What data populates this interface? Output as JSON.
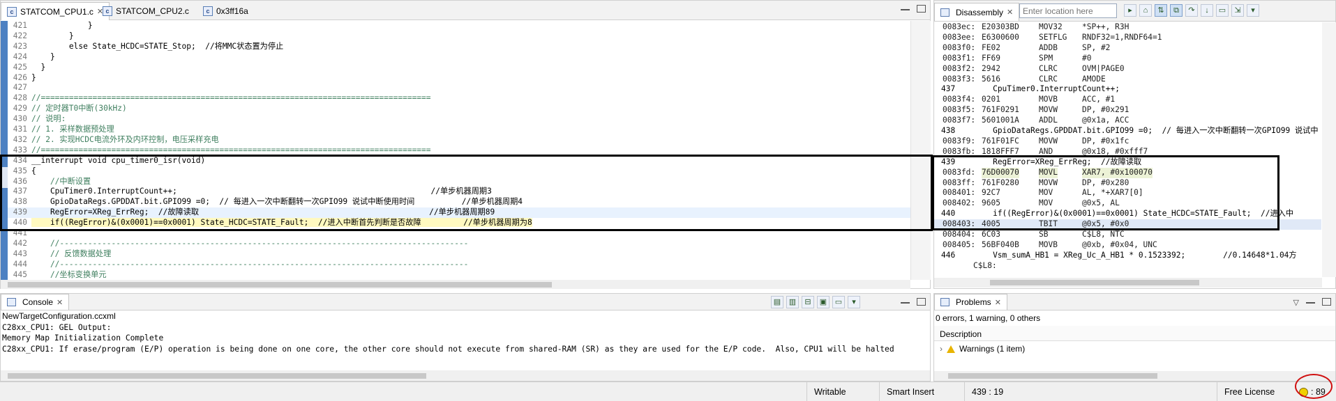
{
  "editor": {
    "tabs": [
      {
        "label": "STATCOM_CPU1.c",
        "active": true
      },
      {
        "label": "STATCOM_CPU2.c",
        "active": false
      },
      {
        "label": "0x3ff16a",
        "active": false
      }
    ],
    "lines": [
      {
        "n": "421",
        "text": "            }"
      },
      {
        "n": "422",
        "text": "        }"
      },
      {
        "n": "423",
        "text": "        else State_HCDC=STATE_Stop;  //将MMC状态置为停止"
      },
      {
        "n": "424",
        "text": "    }"
      },
      {
        "n": "425",
        "text": "  }"
      },
      {
        "n": "426",
        "text": "}"
      },
      {
        "n": "427",
        "text": ""
      },
      {
        "n": "428",
        "text": "//==================================================================================="
      },
      {
        "n": "429",
        "text": "// 定时器T0中断(30kHz)"
      },
      {
        "n": "430",
        "text": "// 说明:"
      },
      {
        "n": "431",
        "text": "// 1. 采样数据预处理"
      },
      {
        "n": "432",
        "text": "// 2. 实现HCDC电流外环及内环控制，电压采样充电"
      },
      {
        "n": "433",
        "text": "//==================================================================================="
      },
      {
        "n": "434",
        "text": "__interrupt void cpu_timer0_isr(void)"
      },
      {
        "n": "435",
        "text": "{"
      },
      {
        "n": "436",
        "text": "    //中断设置"
      },
      {
        "n": "437",
        "text": "    CpuTimer0.InterruptCount++;                                                      //单步机器周期3"
      },
      {
        "n": "438",
        "text": "    GpioDataRegs.GPDDAT.bit.GPIO99 =0;  // 每进入一次中断翻转一次GPIO99 说试中断使用时间          //单步机器周期4"
      },
      {
        "n": "439",
        "text": "    RegError=XReg_ErrReg;  //故障读取                                                 //单步机器周期89"
      },
      {
        "n": "440",
        "text": "    if((RegError)&(0x0001)==0x0001) State_HCDC=STATE_Fault;  //进入中断首先判断是否故障         //单步机器周期为8"
      },
      {
        "n": "441",
        "text": ""
      },
      {
        "n": "442",
        "text": "    //---------------------------------------------------------------------------------------"
      },
      {
        "n": "443",
        "text": "    // 反馈数据处理"
      },
      {
        "n": "444",
        "text": "    //---------------------------------------------------------------------------------------"
      },
      {
        "n": "445",
        "text": "    //坐标变换单元"
      }
    ]
  },
  "disassembly": {
    "tab_label": "Disassembly",
    "location_placeholder": "Enter location here",
    "rows": [
      {
        "kind": "ins",
        "addr": "0083ec:",
        "bytes": "E20303BD",
        "op": "MOV32",
        "arg": "*SP++, R3H"
      },
      {
        "kind": "ins",
        "addr": "0083ee:",
        "bytes": "E6300600",
        "op": "SETFLG",
        "arg": "RNDF32=1,RNDF64=1"
      },
      {
        "kind": "ins",
        "addr": "0083f0:",
        "bytes": "FE02",
        "op": "ADDB",
        "arg": "SP, #2"
      },
      {
        "kind": "ins",
        "addr": "0083f1:",
        "bytes": "FF69",
        "op": "SPM",
        "arg": "#0"
      },
      {
        "kind": "ins",
        "addr": "0083f2:",
        "bytes": "2942",
        "op": "CLRC",
        "arg": "OVM|PAGE0"
      },
      {
        "kind": "ins",
        "addr": "0083f3:",
        "bytes": "5616",
        "op": "CLRC",
        "arg": "AMODE"
      },
      {
        "kind": "src",
        "text": "437        CpuTimer0.InterruptCount++;"
      },
      {
        "kind": "ins",
        "addr": "0083f4:",
        "bytes": "0201",
        "op": "MOVB",
        "arg": "ACC, #1"
      },
      {
        "kind": "ins",
        "addr": "0083f5:",
        "bytes": "761F0291",
        "op": "MOVW",
        "arg": "DP, #0x291"
      },
      {
        "kind": "ins",
        "addr": "0083f7:",
        "bytes": "5601001A",
        "op": "ADDL",
        "arg": "@0x1a, ACC"
      },
      {
        "kind": "src",
        "text": "438        GpioDataRegs.GPDDAT.bit.GPIO99 =0;  // 每进入一次中断翻转一次GPIO99 说试中"
      },
      {
        "kind": "ins",
        "addr": "0083f9:",
        "bytes": "761F01FC",
        "op": "MOVW",
        "arg": "DP, #0x1fc"
      },
      {
        "kind": "ins",
        "addr": "0083fb:",
        "bytes": "1818FFF7",
        "op": "AND",
        "arg": "@0x18, #0xfff7"
      },
      {
        "kind": "src",
        "text": "439        RegError=XReg_ErrReg;  //故障读取"
      },
      {
        "kind": "ins",
        "hl": true,
        "addr": "0083fd:",
        "bytes": "76D00070",
        "op": "MOVL",
        "arg": "XAR7, #0x100070"
      },
      {
        "kind": "ins",
        "addr": "0083ff:",
        "bytes": "761F0280",
        "op": "MOVW",
        "arg": "DP, #0x280"
      },
      {
        "kind": "ins",
        "addr": "008401:",
        "bytes": "92C7",
        "op": "MOV",
        "arg": "AL, *+XAR7[0]"
      },
      {
        "kind": "ins",
        "addr": "008402:",
        "bytes": "9605",
        "op": "MOV",
        "arg": "@0x5, AL"
      },
      {
        "kind": "src",
        "text": "440        if((RegError)&(0x0001)==0x0001) State_HCDC=STATE_Fault;  //进入中"
      },
      {
        "kind": "ins",
        "pc": true,
        "addr": "008403:",
        "bytes": "4005",
        "op": "TBIT",
        "arg": "@0x5, #0x0"
      },
      {
        "kind": "ins",
        "addr": "008404:",
        "bytes": "6C03",
        "op": "SB",
        "arg": "C$L8, NTC"
      },
      {
        "kind": "ins",
        "addr": "008405:",
        "bytes": "56BF040B",
        "op": "MOVB",
        "arg": "@0xb, #0x04, UNC"
      },
      {
        "kind": "src",
        "text": "446        Vsm_sumA_HB1 = XReg_Uc_A_HB1 * 0.1523392;        //0.14648*1.04方"
      },
      {
        "kind": "lab",
        "text": "C$L8:"
      }
    ]
  },
  "console": {
    "tab_label": "Console",
    "config": "NewTargetConfiguration.ccxml",
    "lines": [
      "C28xx_CPU1: GEL Output:",
      "Memory Map Initialization Complete",
      "C28xx_CPU1: If erase/program (E/P) operation is being done on one core, the other core should not execute from shared-RAM (SR) as they are used for the E/P code.  Also, CPU1 will be halted"
    ]
  },
  "problems": {
    "tab_label": "Problems",
    "summary": "0 errors, 1 warning, 0 others",
    "column": "Description",
    "warning_group": "Warnings (1 item)"
  },
  "status": {
    "writable": "Writable",
    "insert": "Smart Insert",
    "position": "439 : 19",
    "license": "Free License",
    "cycles": ": 89"
  }
}
